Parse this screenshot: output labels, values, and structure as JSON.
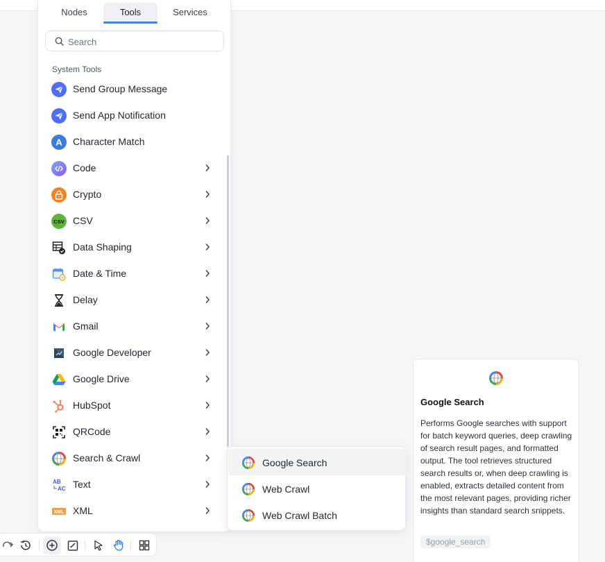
{
  "tabs": {
    "nodes": "Nodes",
    "tools": "Tools",
    "services": "Services"
  },
  "search": {
    "placeholder": "Search"
  },
  "section_title": "System Tools",
  "items": [
    {
      "label": "Send Group Message",
      "icon": "send-group-message-icon"
    },
    {
      "label": "Send App Notification",
      "icon": "send-app-notification-icon"
    },
    {
      "label": "Character Match",
      "icon": "character-match-icon"
    },
    {
      "label": "Code",
      "icon": "code-icon"
    },
    {
      "label": "Crypto",
      "icon": "lock-icon"
    },
    {
      "label": "CSV",
      "icon": "csv-icon"
    },
    {
      "label": "Data Shaping",
      "icon": "data-shaping-icon"
    },
    {
      "label": "Date & Time",
      "icon": "calendar-icon"
    },
    {
      "label": "Delay",
      "icon": "hourglass-icon"
    },
    {
      "label": "Gmail",
      "icon": "gmail-icon"
    },
    {
      "label": "Google Developer",
      "icon": "google-developer-icon"
    },
    {
      "label": "Google Drive",
      "icon": "google-drive-icon"
    },
    {
      "label": "HubSpot",
      "icon": "hubspot-icon"
    },
    {
      "label": "QRCode",
      "icon": "qrcode-icon"
    },
    {
      "label": "Search & Crawl",
      "icon": "globe-icon"
    },
    {
      "label": "Text",
      "icon": "text-icon"
    },
    {
      "label": "XML",
      "icon": "xml-icon"
    }
  ],
  "submenu": [
    {
      "label": "Google Search"
    },
    {
      "label": "Web Crawl"
    },
    {
      "label": "Web Crawl Batch"
    }
  ],
  "preview": {
    "title": "Google Search",
    "description": "Performs Google searches with support for batch keyword queries, deep crawling of search result pages, and formatted output. The tool retrieves structured search results or, when deep crawling is enabled, extracts detailed content from the most relevant pages, providing richer insights than standard search snippets.",
    "tag": "$google_search"
  },
  "colors": {
    "accent": "#3b82f6",
    "send_icon": "#4f6ef7"
  }
}
